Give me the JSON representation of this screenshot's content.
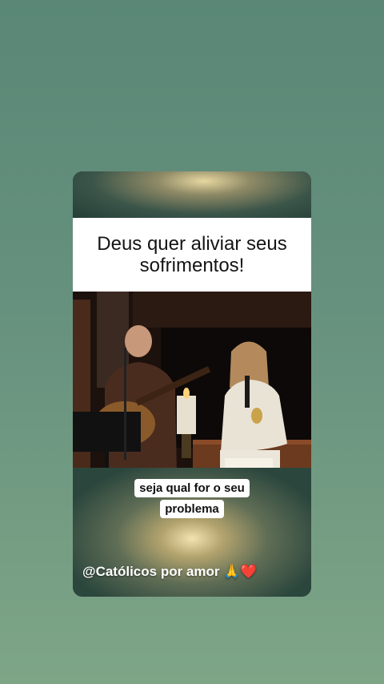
{
  "post": {
    "title": "Deus quer aliviar seus sofrimentos!",
    "caption_line1": "seja qual for o seu",
    "caption_line2": "problema",
    "handle": "@Católicos por amor 🙏❤️"
  }
}
